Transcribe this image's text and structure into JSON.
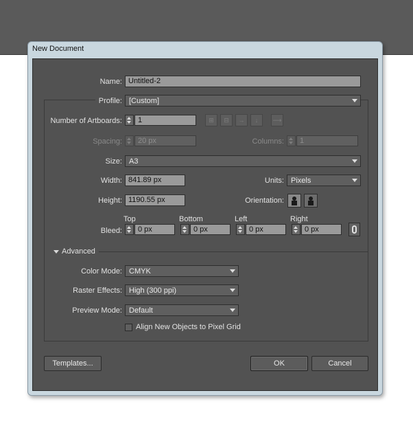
{
  "window": {
    "title": "New Document"
  },
  "form": {
    "name_label": "Name:",
    "name_value": "Untitled-2",
    "profile_label": "Profile:",
    "profile_value": "[Custom]",
    "artboards_label": "Number of Artboards:",
    "artboards_value": "1",
    "spacing_label": "Spacing:",
    "spacing_value": "20 px",
    "columns_label": "Columns:",
    "columns_value": "1",
    "size_label": "Size:",
    "size_value": "A3",
    "width_label": "Width:",
    "width_value": "841.89 px",
    "units_label": "Units:",
    "units_value": "Pixels",
    "height_label": "Height:",
    "height_value": "1190.55 px",
    "orientation_label": "Orientation:",
    "bleed_label": "Bleed:",
    "bleed": {
      "top_label": "Top",
      "top_value": "0 px",
      "bottom_label": "Bottom",
      "bottom_value": "0 px",
      "left_label": "Left",
      "left_value": "0 px",
      "right_label": "Right",
      "right_value": "0 px"
    }
  },
  "advanced": {
    "section_label": "Advanced",
    "color_mode_label": "Color Mode:",
    "color_mode_value": "CMYK",
    "raster_label": "Raster Effects:",
    "raster_value": "High (300 ppi)",
    "preview_label": "Preview Mode:",
    "preview_value": "Default",
    "align_label": "Align New Objects to Pixel Grid",
    "align_checked": false
  },
  "buttons": {
    "templates": "Templates...",
    "ok": "OK",
    "cancel": "Cancel"
  },
  "icons": {
    "arrange_grid_by_row": "arrange-grid-by-row-icon",
    "arrange_grid_by_column": "arrange-grid-by-column-icon",
    "arrange_by_row": "arrange-by-row-icon",
    "arrange_by_column": "arrange-by-column-icon",
    "right_to_left": "right-to-left-layout-icon",
    "portrait": "portrait-icon",
    "landscape": "landscape-icon",
    "link_bleed": "link-icon"
  }
}
